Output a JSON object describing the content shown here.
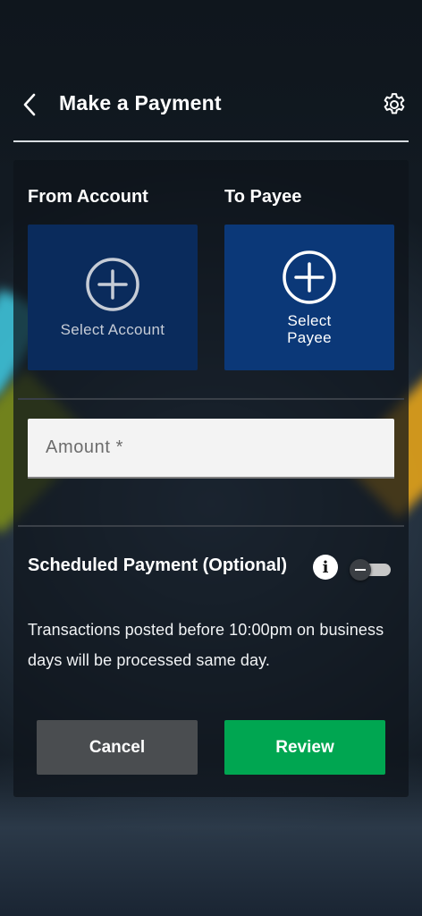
{
  "header": {
    "title": "Make a Payment"
  },
  "from": {
    "label": "From Account",
    "tile_label": "Select Account"
  },
  "to": {
    "label": "To Payee",
    "tile_label_line1": "Select",
    "tile_label_line2": "Payee"
  },
  "amount": {
    "placeholder": "Amount *",
    "value": ""
  },
  "scheduled": {
    "label": "Scheduled Payment (Optional)",
    "info_glyph": "i",
    "enabled": false
  },
  "notice": {
    "text": "Transactions posted before 10:00pm on business days will be processed same day."
  },
  "actions": {
    "cancel_label": "Cancel",
    "review_label": "Review"
  },
  "colors": {
    "tile_from": "#0a2b5c",
    "tile_to": "#0b3878",
    "review": "#00a651",
    "cancel": "#4a4d50"
  },
  "icons": {
    "back": "chevron-left-icon",
    "settings": "gear-icon",
    "add": "plus-circle-icon",
    "info": "info-icon"
  }
}
